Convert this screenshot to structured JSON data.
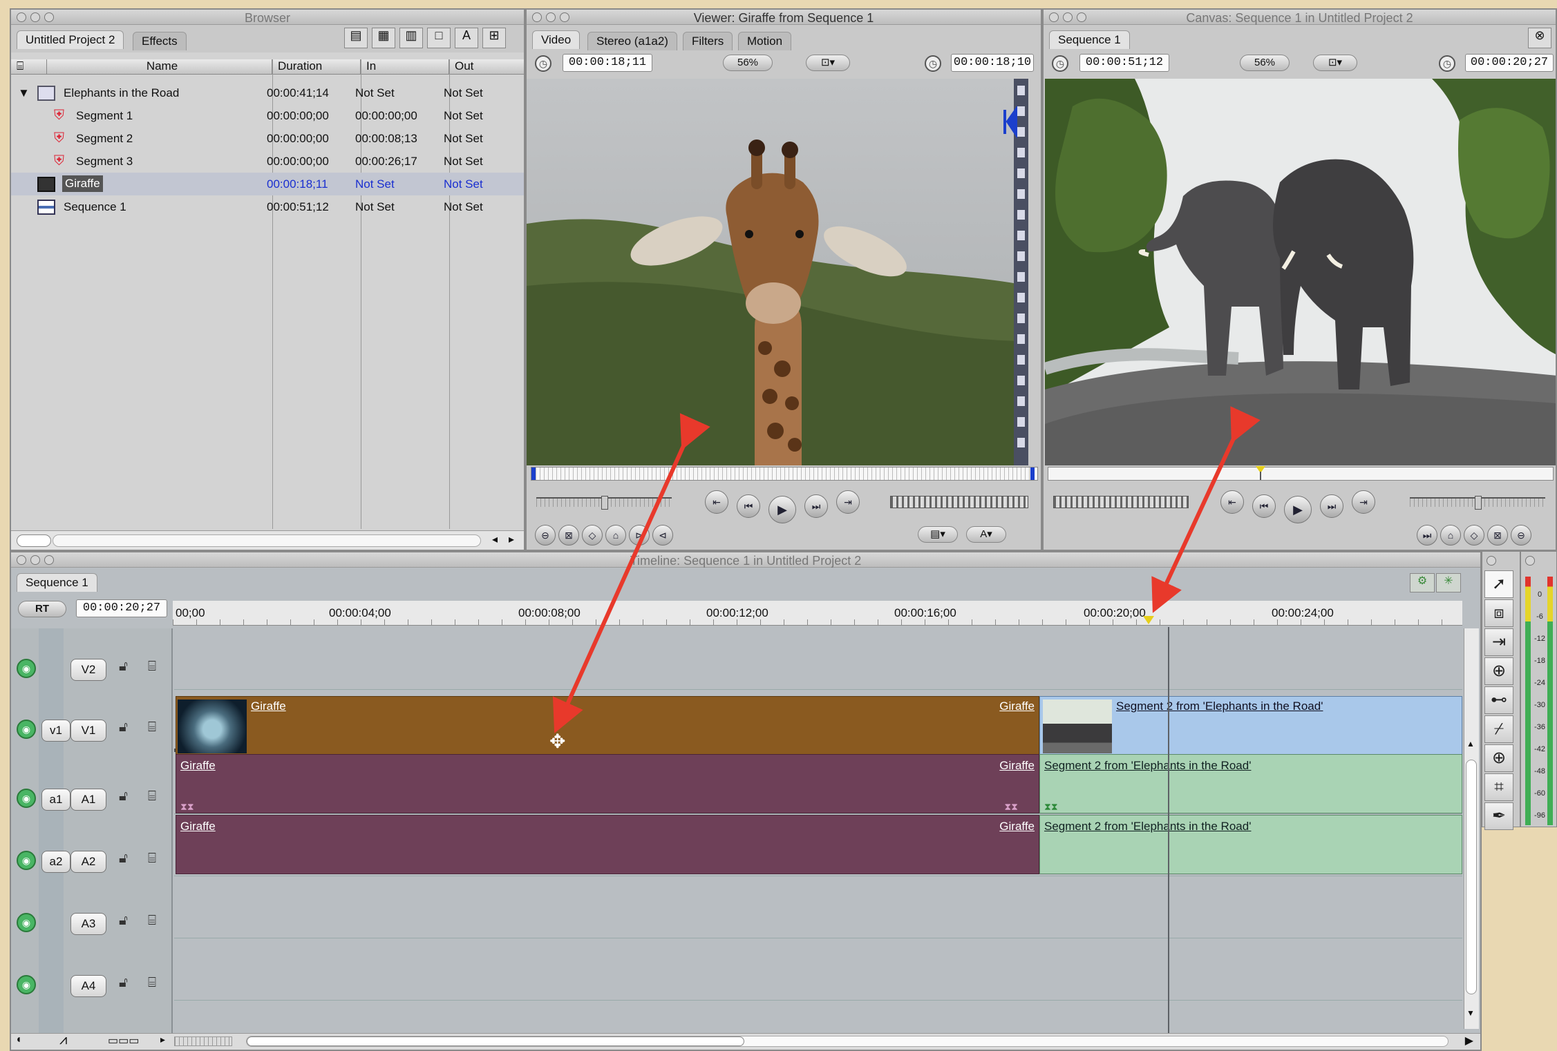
{
  "browser": {
    "title": "Browser",
    "tabs": [
      "Untitled Project 2",
      "Effects"
    ],
    "columns": [
      "Name",
      "Duration",
      "In",
      "Out"
    ],
    "rows": [
      {
        "name": "Elephants in the Road",
        "duration": "00:00:41;14",
        "in": "Not Set",
        "out": "Not Set",
        "icon": "bin-icon"
      },
      {
        "name": "Segment 1",
        "duration": "00:00:00;00",
        "in": "00:00:00;00",
        "out": "Not Set",
        "icon": "subclip-icon"
      },
      {
        "name": "Segment 2",
        "duration": "00:00:00;00",
        "in": "00:00:08;13",
        "out": "Not Set",
        "icon": "subclip-icon"
      },
      {
        "name": "Segment 3",
        "duration": "00:00:00;00",
        "in": "00:00:26;17",
        "out": "Not Set",
        "icon": "subclip-icon"
      },
      {
        "name": "Giraffe",
        "duration": "00:00:18;11",
        "in": "Not Set",
        "out": "Not Set",
        "icon": "clip-icon"
      },
      {
        "name": "Sequence 1",
        "duration": "00:00:51;12",
        "in": "Not Set",
        "out": "Not Set",
        "icon": "sequence-icon"
      }
    ]
  },
  "viewer": {
    "title": "Viewer: Giraffe from Sequence 1",
    "tabs": [
      "Video",
      "Stereo (a1a2)",
      "Filters",
      "Motion"
    ],
    "duration": "00:00:18;11",
    "zoom": "56%",
    "current_tc": "00:00:18;10"
  },
  "canvas": {
    "title": "Canvas: Sequence 1 in Untitled Project 2",
    "tab": "Sequence 1",
    "duration": "00:00:51;12",
    "zoom": "56%",
    "current_tc": "00:00:20;27"
  },
  "timeline": {
    "title": "Timeline: Sequence 1 in Untitled Project 2",
    "tab": "Sequence 1",
    "rt": "RT",
    "current_tc": "00:00:20;27",
    "ruler": [
      "00;00",
      "00:00:04;00",
      "00:00:08;00",
      "00:00:12;00",
      "00:00:16;00",
      "00:00:20;00",
      "00:00:24;00"
    ],
    "tracks": {
      "v2": "V2",
      "v1src": "v1",
      "v1": "V1",
      "a1src": "a1",
      "a1": "A1",
      "a2src": "a2",
      "a2": "A2",
      "a3": "A3",
      "a4": "A4"
    },
    "clips": {
      "giraffe": "Giraffe",
      "segment2_video": "Segment 2 from 'Elephants in the Road'",
      "segment2_audio": "Segment 2 from 'Elephants in the Road'"
    }
  },
  "audio_meter": {
    "scale": [
      "0",
      "-6",
      "-12",
      "-18",
      "-24",
      "-30",
      "-36",
      "-42",
      "-48",
      "-60",
      "-96"
    ]
  },
  "colors": {
    "video_clip": "#8a5a20",
    "segment_video": "#a9c8ea",
    "audio_clip": "#6e4058",
    "segment_audio": "#a9d3b4",
    "arrow": "#e8392b"
  }
}
